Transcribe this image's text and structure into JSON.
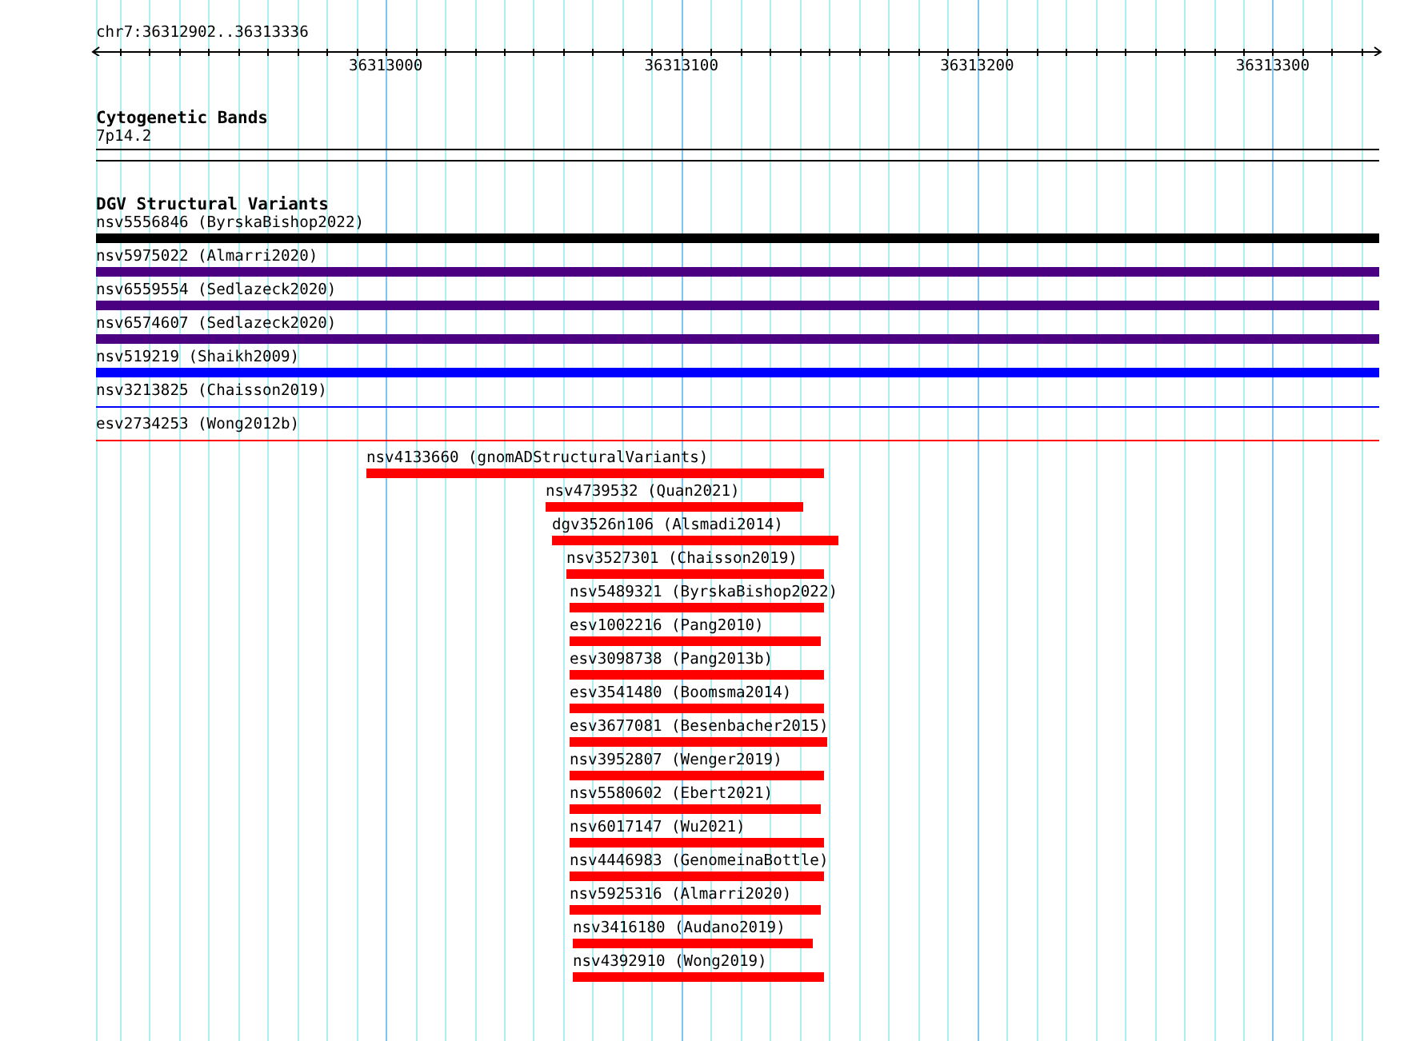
{
  "ruler": {
    "location": "chr7:36312902..36313336",
    "ticks": [
      "36313000",
      "36313100",
      "36313200",
      "36313300"
    ]
  },
  "cytogenetic_bands": {
    "title": "Cytogenetic Bands",
    "band": "7p14.2"
  },
  "dgv_track": {
    "title": "DGV Structural Variants",
    "features": [
      {
        "label": "nsv5556846 (ByrskaBishop2022)",
        "color": "#000000",
        "kind": "bar"
      },
      {
        "label": "nsv5975022 (Almarri2020)",
        "color": "#4b0082",
        "kind": "bar"
      },
      {
        "label": "nsv6559554 (Sedlazeck2020)",
        "color": "#4b0082",
        "kind": "bar"
      },
      {
        "label": "nsv6574607 (Sedlazeck2020)",
        "color": "#4b0082",
        "kind": "bar"
      },
      {
        "label": "nsv519219 (Shaikh2009)",
        "color": "#0000ff",
        "kind": "bar"
      },
      {
        "label": "nsv3213825 (Chaisson2019)",
        "color": "#0000ff",
        "kind": "line"
      },
      {
        "label": "esv2734253 (Wong2012b)",
        "color": "#ff0000",
        "kind": "line"
      },
      {
        "label": "nsv4133660 (gnomADStructuralVariants)",
        "color": "#ff0000",
        "kind": "bar"
      },
      {
        "label": "nsv4739532 (Quan2021)",
        "color": "#ff0000",
        "kind": "bar"
      },
      {
        "label": "dgv3526n106 (Alsmadi2014)",
        "color": "#ff0000",
        "kind": "bar"
      },
      {
        "label": "nsv3527301 (Chaisson2019)",
        "color": "#ff0000",
        "kind": "bar"
      },
      {
        "label": "nsv5489321 (ByrskaBishop2022)",
        "color": "#ff0000",
        "kind": "bar"
      },
      {
        "label": "esv1002216 (Pang2010)",
        "color": "#ff0000",
        "kind": "bar"
      },
      {
        "label": "esv3098738 (Pang2013b)",
        "color": "#ff0000",
        "kind": "bar"
      },
      {
        "label": "esv3541480 (Boomsma2014)",
        "color": "#ff0000",
        "kind": "bar"
      },
      {
        "label": "esv3677081 (Besenbacher2015)",
        "color": "#ff0000",
        "kind": "bar"
      },
      {
        "label": "nsv3952807 (Wenger2019)",
        "color": "#ff0000",
        "kind": "bar"
      },
      {
        "label": "nsv5580602 (Ebert2021)",
        "color": "#ff0000",
        "kind": "bar"
      },
      {
        "label": "nsv6017147 (Wu2021)",
        "color": "#ff0000",
        "kind": "bar"
      },
      {
        "label": "nsv4446983 (GenomeinaBottle)",
        "color": "#ff0000",
        "kind": "bar"
      },
      {
        "label": "nsv5925316 (Almarri2020)",
        "color": "#ff0000",
        "kind": "bar"
      },
      {
        "label": "nsv3416180 (Audano2019)",
        "color": "#ff0000",
        "kind": "bar"
      },
      {
        "label": "nsv4392910 (Wong2019)",
        "color": "#ff0000",
        "kind": "bar"
      }
    ]
  }
}
